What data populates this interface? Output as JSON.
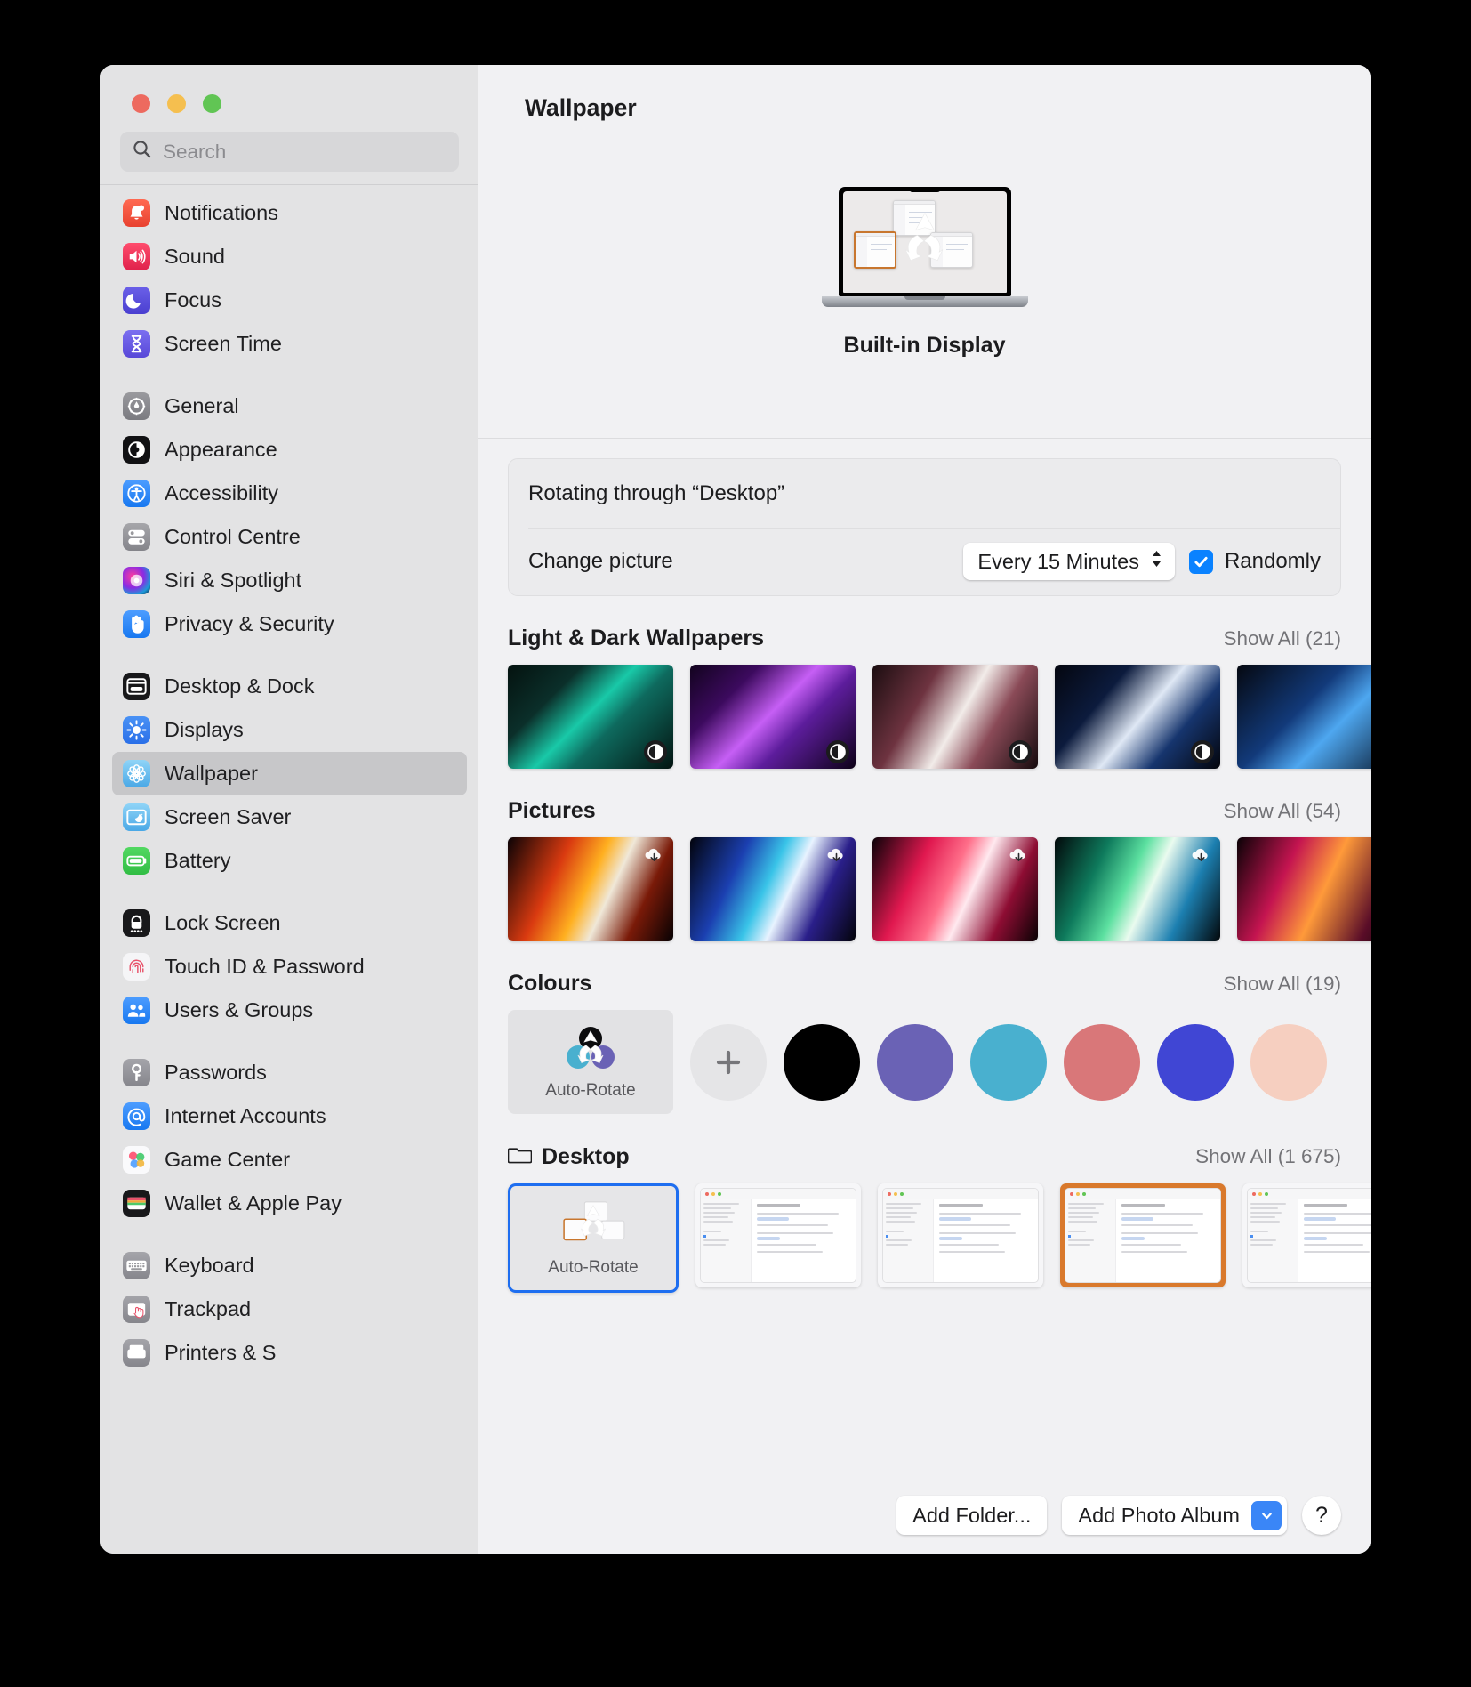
{
  "window": {
    "traffic_lights": [
      "close",
      "minimize",
      "zoom"
    ],
    "search": {
      "placeholder": "Search",
      "value": ""
    }
  },
  "sidebar": {
    "groups": [
      {
        "items": [
          {
            "label": "Notifications",
            "icon": "bell-icon",
            "selected": false
          },
          {
            "label": "Sound",
            "icon": "speaker-icon",
            "selected": false
          },
          {
            "label": "Focus",
            "icon": "moon-icon",
            "selected": false
          },
          {
            "label": "Screen Time",
            "icon": "hourglass-icon",
            "selected": false
          }
        ]
      },
      {
        "items": [
          {
            "label": "General",
            "icon": "gear-icon",
            "selected": false
          },
          {
            "label": "Appearance",
            "icon": "appearance-icon",
            "selected": false
          },
          {
            "label": "Accessibility",
            "icon": "accessibility-icon",
            "selected": false
          },
          {
            "label": "Control Centre",
            "icon": "control-centre-icon",
            "selected": false
          },
          {
            "label": "Siri & Spotlight",
            "icon": "siri-icon",
            "selected": false
          },
          {
            "label": "Privacy & Security",
            "icon": "hand-icon",
            "selected": false
          }
        ]
      },
      {
        "items": [
          {
            "label": "Desktop & Dock",
            "icon": "desktop-dock-icon",
            "selected": false
          },
          {
            "label": "Displays",
            "icon": "brightness-icon",
            "selected": false
          },
          {
            "label": "Wallpaper",
            "icon": "wallpaper-icon",
            "selected": true
          },
          {
            "label": "Screen Saver",
            "icon": "screen-saver-icon",
            "selected": false
          },
          {
            "label": "Battery",
            "icon": "battery-icon",
            "selected": false
          }
        ]
      },
      {
        "items": [
          {
            "label": "Lock Screen",
            "icon": "lock-icon",
            "selected": false
          },
          {
            "label": "Touch ID & Password",
            "icon": "fingerprint-icon",
            "selected": false
          },
          {
            "label": "Users & Groups",
            "icon": "users-icon",
            "selected": false
          }
        ]
      },
      {
        "items": [
          {
            "label": "Passwords",
            "icon": "key-icon",
            "selected": false
          },
          {
            "label": "Internet Accounts",
            "icon": "at-sign-icon",
            "selected": false
          },
          {
            "label": "Game Center",
            "icon": "game-center-icon",
            "selected": false
          },
          {
            "label": "Wallet & Apple Pay",
            "icon": "wallet-icon",
            "selected": false
          }
        ]
      },
      {
        "items": [
          {
            "label": "Keyboard",
            "icon": "keyboard-icon",
            "selected": false
          },
          {
            "label": "Trackpad",
            "icon": "trackpad-icon",
            "selected": false
          },
          {
            "label": "Printers & S",
            "icon": "printer-icon",
            "selected": false
          }
        ]
      }
    ]
  },
  "main": {
    "title": "Wallpaper",
    "display": {
      "name": "Built-in Display",
      "preview": "auto-rotate"
    },
    "rotation": {
      "heading": "Rotating through “Desktop”",
      "change_picture_label": "Change picture",
      "interval_value": "Every 15 Minutes",
      "randomly_label": "Randomly",
      "randomly_checked": true
    },
    "sections": [
      {
        "title": "Light & Dark Wallpapers",
        "show_all": "Show All (21)",
        "kind": "gradient",
        "items": [
          {
            "badge": "light-dark-icon",
            "css": "linear-gradient(135deg,#04120f 0%,#0b2f2a 28%,#19c9a8 48%,#0e6a5e 62%,#031310 100%)"
          },
          {
            "badge": "light-dark-icon",
            "css": "linear-gradient(135deg,#12031e 0%,#3c0a5e 26%,#c65ff5 48%,#5d1d9c 64%,#0d0117 100%)"
          },
          {
            "badge": "light-dark-icon",
            "css": "linear-gradient(120deg,#1b0d10 0%,#6e3340 30%,#f2ece9 52%,#8a4a57 70%,#150a0d 100%)"
          },
          {
            "badge": "light-dark-icon",
            "css": "linear-gradient(130deg,#04060f 0%,#0c1b3d 30%,#dfe8f5 52%,#16356e 72%,#03040a 100%)"
          },
          {
            "badge": "light-dark-icon",
            "css": "linear-gradient(135deg,#050810 0%,#123a7a 40%,#4ea7f0 60%,#081428 100%)"
          }
        ]
      },
      {
        "title": "Pictures",
        "show_all": "Show All (54)",
        "kind": "gradient",
        "items": [
          {
            "badge": "download-icon",
            "css": "linear-gradient(115deg,#0a0205 0%,#d93a10 30%,#ffb020 48%,#f0e8d8 60%,#7a1a08 78%,#060103 100%)"
          },
          {
            "badge": "download-icon",
            "css": "linear-gradient(115deg,#02030c 0%,#1b3fb0 28%,#39c4e8 46%,#e8f3ff 58%,#2a1f8a 76%,#03030a 100%)"
          },
          {
            "badge": "download-icon",
            "css": "linear-gradient(115deg,#0b0208 0%,#e0184f 28%,#ff6f8a 46%,#ffe9ef 58%,#8e0d33 78%,#080103 100%)"
          },
          {
            "badge": "download-icon",
            "css": "linear-gradient(115deg,#02080a 0%,#0e7a5c 26%,#5ce0a0 44%,#eafbef 56%,#1c7fb0 76%,#020609 100%)"
          },
          {
            "badge": "download-icon",
            "css": "linear-gradient(115deg,#0a0206 0%,#c41450 30%,#ff9a3a 52%,#5a0d28 80%,#060103 100%)"
          }
        ]
      },
      {
        "title": "Colours",
        "show_all": "Show All (19)",
        "kind": "colors",
        "auto_rotate_label": "Auto-Rotate",
        "add_label": "+",
        "swatches": [
          "#000000",
          "#6a62b5",
          "#49b0cf",
          "#d97779",
          "#4046d4",
          "#f6cfc0"
        ]
      },
      {
        "title": "Desktop",
        "show_all": "Show All (1 675)",
        "kind": "desktop",
        "folder_icon": "folder-icon",
        "auto_rotate_label": "Auto-Rotate",
        "items": [
          {
            "accent": "#ffffff",
            "selected": true
          },
          {
            "accent": "#ffffff",
            "selected": false
          },
          {
            "accent": "#ffffff",
            "selected": false
          },
          {
            "accent": "#d9792c",
            "selected": false
          },
          {
            "accent": "#ffffff",
            "selected": false
          }
        ]
      }
    ],
    "buttons": {
      "add_folder": "Add Folder...",
      "add_photo_album": "Add Photo Album",
      "help": "?"
    }
  }
}
